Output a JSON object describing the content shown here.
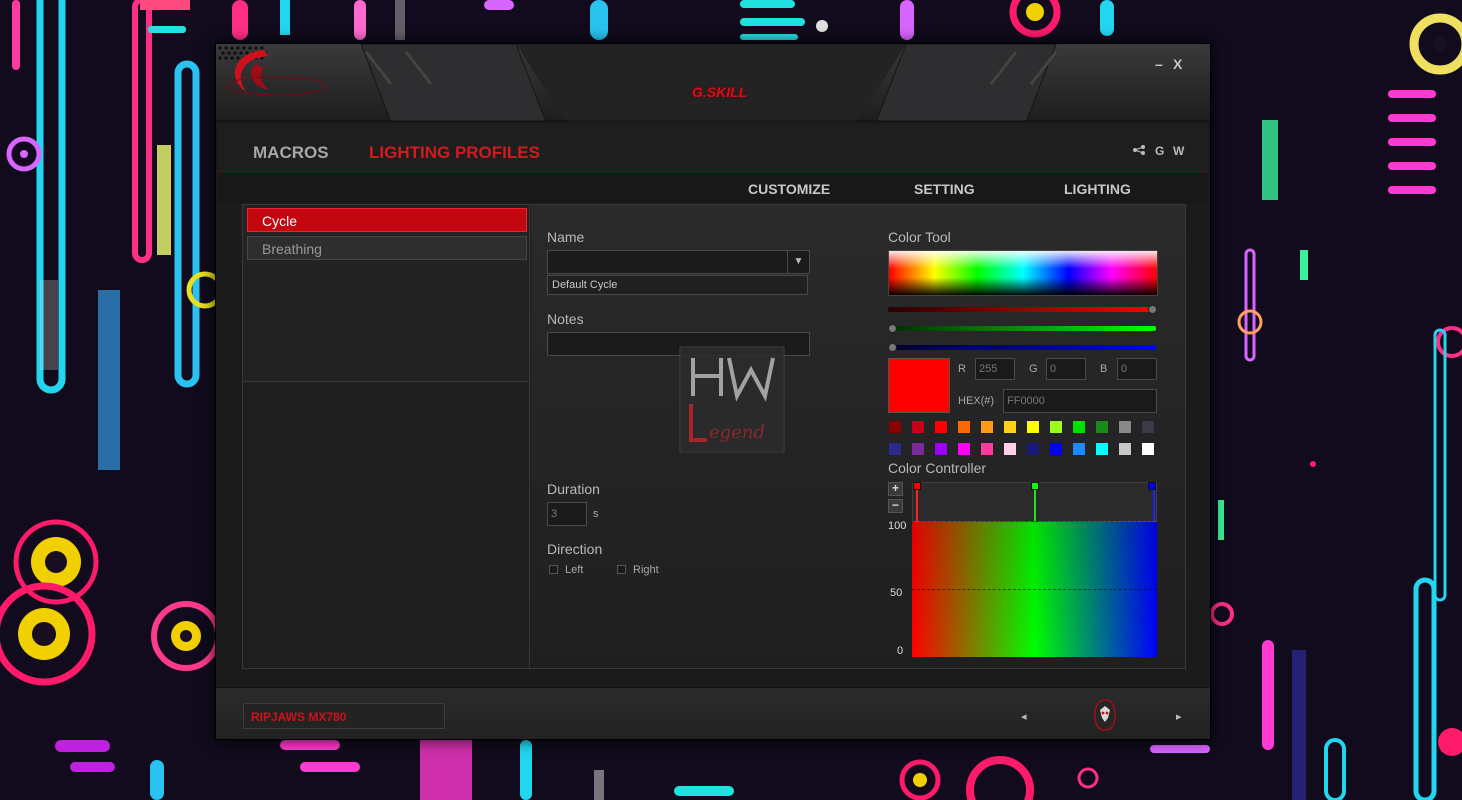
{
  "window": {
    "brand": "G.SKILL",
    "minimize_label": "–",
    "close_label": "X"
  },
  "topnav": {
    "tabs": [
      {
        "label": "MACROS",
        "active": false
      },
      {
        "label": "LIGHTING PROFILES",
        "active": true
      }
    ],
    "social": [
      "share-icon",
      "G",
      "W"
    ]
  },
  "subtabs": [
    "CUSTOMIZE",
    "SETTING",
    "LIGHTING"
  ],
  "profiles": [
    {
      "label": "Cycle",
      "selected": true
    },
    {
      "label": "Breathing",
      "selected": false
    }
  ],
  "editor": {
    "name_label": "Name",
    "name_value": "",
    "name_option": "Default Cycle",
    "notes_label": "Notes",
    "notes_value": "",
    "duration_label": "Duration",
    "duration_value": "3",
    "duration_unit": "s",
    "direction_label": "Direction",
    "direction_left": "Left",
    "direction_right": "Right"
  },
  "color_tool": {
    "label": "Color Tool",
    "r_label": "R",
    "r_value": "255",
    "g_label": "G",
    "g_value": "0",
    "b_label": "B",
    "b_value": "0",
    "hex_label": "HEX(#)",
    "hex_value": "FF0000",
    "selected_color": "#ff0000",
    "palette_row1": [
      "#8b0000",
      "#c8001a",
      "#ff0000",
      "#ff6a00",
      "#ff9a1a",
      "#ffd21a",
      "#ffff00",
      "#9dff1a",
      "#00e000",
      "#1a8a1a",
      "#8a8a8a",
      "#3a3a48"
    ],
    "palette_row2": [
      "#2a2a8a",
      "#7a2a9a",
      "#9a00ff",
      "#ff00ff",
      "#ff3aa0",
      "#ffd0e8",
      "#1a1a7a",
      "#0000ff",
      "#1a8aff",
      "#00ffff",
      "#c8c8c8",
      "#ffffff"
    ]
  },
  "color_controller": {
    "label": "Color Controller",
    "plus_label": "+",
    "minus_label": "−",
    "y_ticks": [
      "100",
      "50",
      "0"
    ],
    "stops": [
      "#ff0000",
      "#00ff00",
      "#0000ff"
    ]
  },
  "bottombar": {
    "device_name": "RIPJAWS MX780",
    "prev_label": "◂",
    "next_label": "▸"
  },
  "watermark": "HW Legend"
}
